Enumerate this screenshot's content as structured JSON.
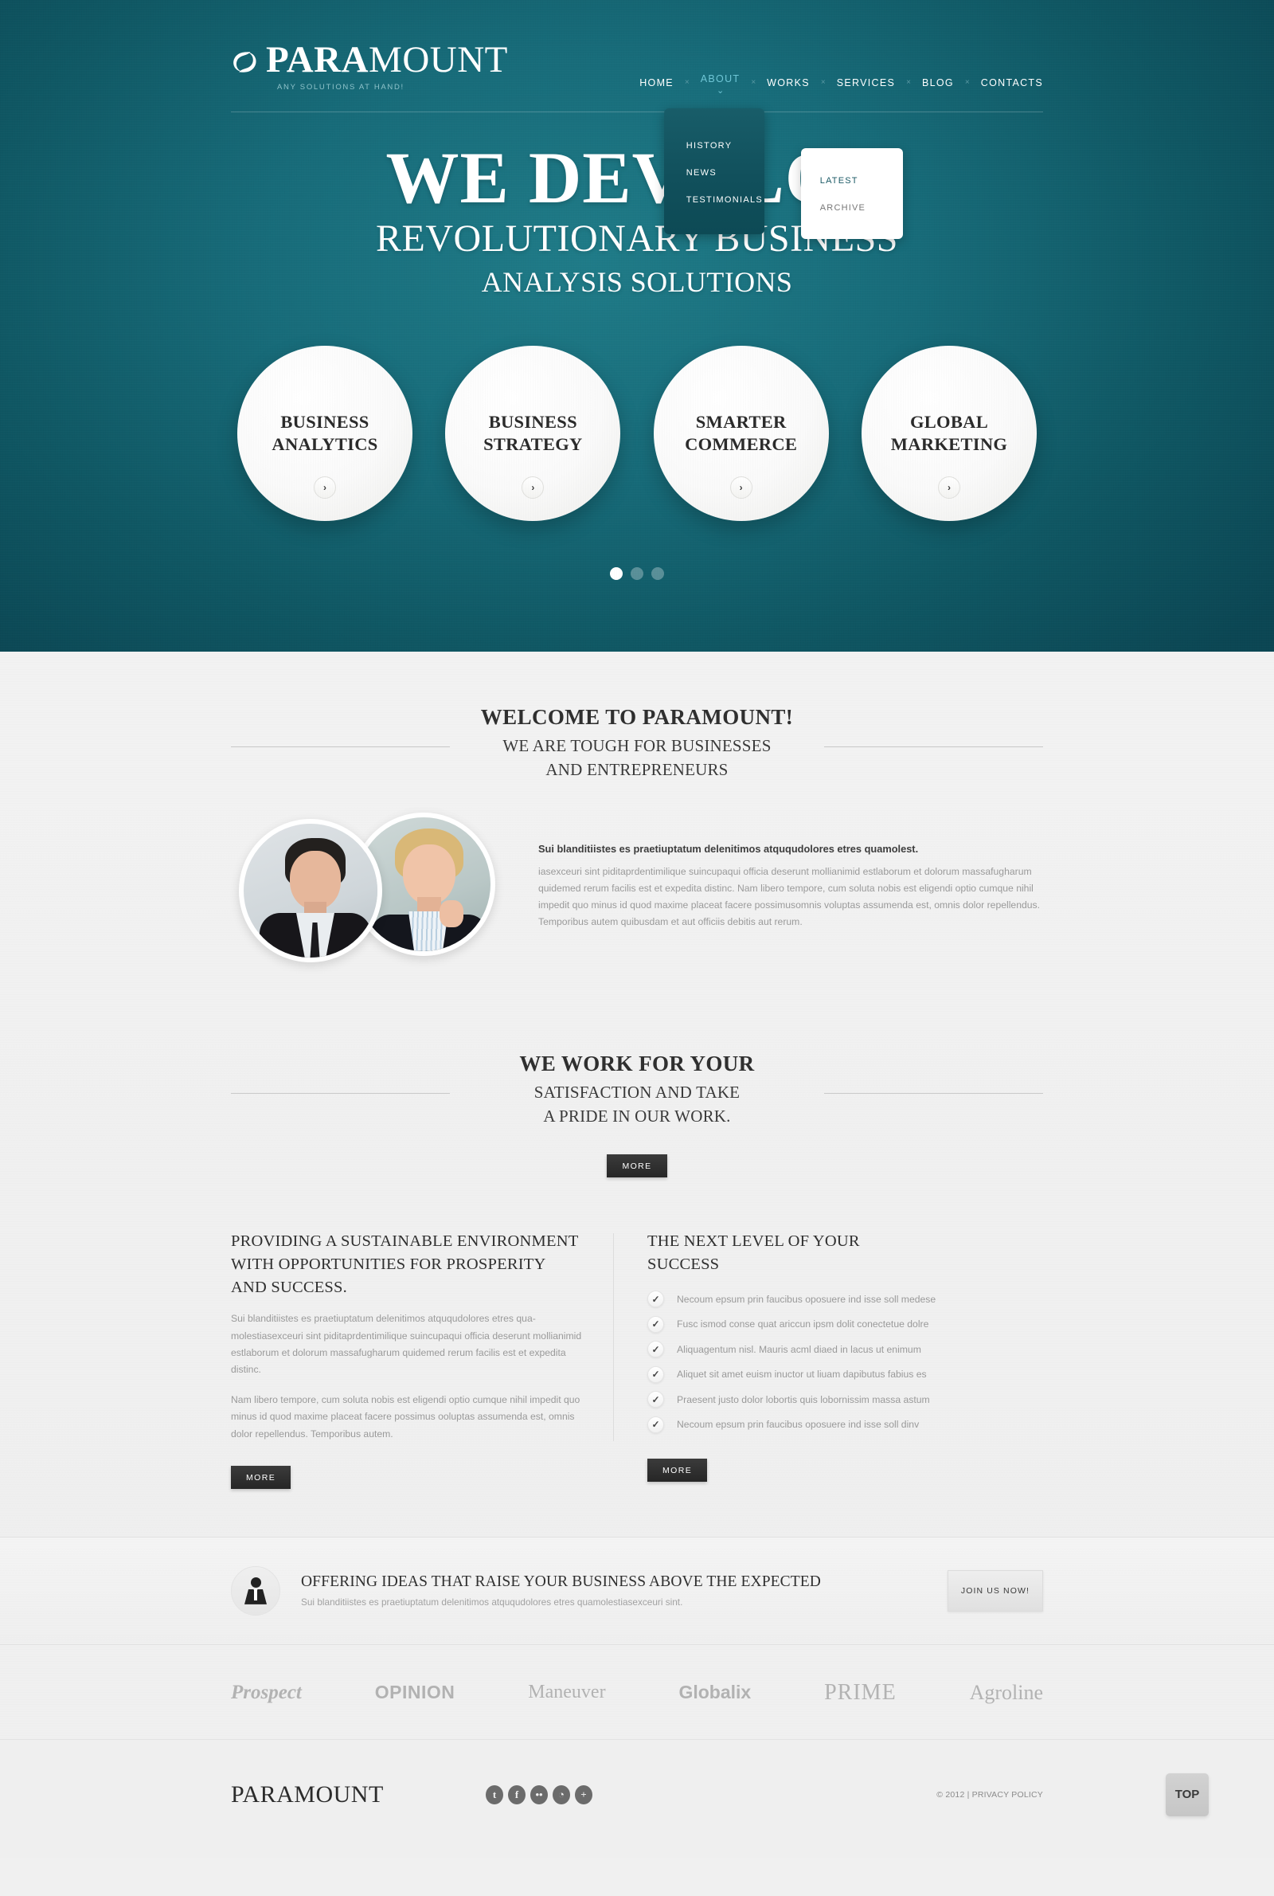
{
  "brand": {
    "name_light": "PARA",
    "name_rest": "MOUNT",
    "full": "PARAMOUNT",
    "tagline": "ANY SOLUTIONS AT HAND!",
    "logo_icon": "swirl-circle-icon"
  },
  "nav": {
    "items": [
      {
        "label": "HOME",
        "active": false
      },
      {
        "label": "ABOUT",
        "active": true
      },
      {
        "label": "WORKS",
        "active": false
      },
      {
        "label": "SERVICES",
        "active": false
      },
      {
        "label": "BLOG",
        "active": false
      },
      {
        "label": "CONTACTS",
        "active": false
      }
    ],
    "separator": "×",
    "caret": "⌄",
    "dropdown": [
      {
        "label": "HISTORY"
      },
      {
        "label": "NEWS"
      },
      {
        "label": "TESTIMONIALS"
      }
    ],
    "submenu": [
      {
        "label": "LATEST",
        "muted": false
      },
      {
        "label": "ARCHIVE",
        "muted": true
      }
    ]
  },
  "hero": {
    "title": "WE DEVELOP",
    "sub1": "REVOLUTIONARY BUSINESS",
    "sub2": "ANALYSIS SOLUTIONS",
    "circles": [
      {
        "line1": "BUSINESS",
        "line2": "ANALYTICS",
        "arrow": "›"
      },
      {
        "line1": "BUSINESS",
        "line2": "STRATEGY",
        "arrow": "›"
      },
      {
        "line1": "SMARTER",
        "line2": "COMMERCE",
        "arrow": "›"
      },
      {
        "line1": "GLOBAL",
        "line2": "MARKETING",
        "arrow": "›"
      }
    ],
    "slider_dots": 3,
    "active_dot": 1
  },
  "welcome": {
    "heading": "WELCOME TO PARAMOUNT!",
    "subheading_l1": "WE ARE TOUGH FOR BUSINESSES",
    "subheading_l2": "AND ENTREPRENEURS",
    "lead": "Sui blanditiistes es praetiuptatum delenitimos atququdolores etres quamolest.",
    "body": "iasexceuri sint piditaprdentimilique suincupaqui officia deserunt mollianimid estlaborum et dolorum massafugharum quidemed rerum facilis est et expedita distinc. Nam libero tempore, cum soluta nobis est eligendi optio cumque nihil impedit quo minus id quod maxime placeat facere possimusomnis voluptas assumenda est, omnis dolor repellendus. Temporibus autem quibusdam et aut officiis debitis aut rerum.",
    "photo1_alt": "businessman-portrait",
    "photo2_alt": "businesswoman-portrait"
  },
  "work": {
    "heading": "WE WORK FOR YOUR",
    "subheading_l1": "SATISFACTION AND TAKE",
    "subheading_l2": "A PRIDE IN OUR WORK.",
    "more_label": "MORE"
  },
  "columns": {
    "left": {
      "heading_l1": "PROVIDING A SUSTAINABLE ENVIRONMENT",
      "heading_l2": "WITH OPPORTUNITIES FOR PROSPERITY",
      "heading_l3": "AND SUCCESS.",
      "p1": "Sui blanditiistes es praetiuptatum delenitimos atququdolores etres qua-molestiasexceuri sint piditaprdentimilique suincupaqui officia deserunt mollianimid estlaborum et dolorum massafugharum quidemed rerum facilis est et expedita distinc.",
      "p2": "Nam libero tempore, cum soluta nobis est eligendi optio cumque nihil impedit quo minus id quod maxime placeat facere possimus ooluptas assumenda est, omnis dolor repellendus. Temporibus autem.",
      "more_label": "MORE"
    },
    "right": {
      "heading_l1": "THE NEXT LEVEL OF YOUR",
      "heading_l2": "SUCCESS",
      "check_icon": "✓",
      "items": [
        "Necoum epsum prin faucibus oposuere ind isse soll medese",
        "Fusc ismod conse quat ariccun ipsm dolit conectetue dolre",
        "Aliquagentum nisl. Mauris acml diaed in lacus ut enimum",
        "Aliquet sit amet euism inuctor ut liuam dapibutus fabius es",
        "Praesent justo dolor lobortis quis lobornissim massa astum",
        "Necoum epsum prin faucibus oposuere ind isse soll dinv"
      ],
      "more_label": "MORE"
    }
  },
  "cta": {
    "icon": "businessperson-icon",
    "heading": "OFFERING IDEAS THAT RAISE YOUR BUSINESS ABOVE THE EXPECTED",
    "text": "Sui blanditiistes es praetiuptatum delenitimos atququdolores etres quamolestiasexceuri sint.",
    "button_label": "JOIN US NOW!"
  },
  "partners": [
    {
      "name": "Prospect",
      "style": "pt1"
    },
    {
      "name": "OPINION",
      "style": "pt2"
    },
    {
      "name": "Maneuver",
      "style": "pt3"
    },
    {
      "name": "Globalix",
      "style": "pt4"
    },
    {
      "name": "PRIME",
      "style": "pt5"
    },
    {
      "name": "Agroline",
      "style": "pt6"
    }
  ],
  "footer": {
    "logo": "PARAMOUNT",
    "socials": [
      {
        "icon": "twitter-icon",
        "glyph": "t"
      },
      {
        "icon": "facebook-icon",
        "glyph": "f"
      },
      {
        "icon": "flickr-icon",
        "glyph": "••"
      },
      {
        "icon": "rss-icon",
        "glyph": "◔"
      },
      {
        "icon": "plus-icon",
        "glyph": "+"
      }
    ],
    "copyright": "© 2012 | PRIVACY POLICY",
    "top_label": "TOP"
  },
  "colors": {
    "hero_teal": "#176b79",
    "accent_cyan": "#6fc6d6",
    "dark_button": "#2b2b2b",
    "page_bg": "#f0f0f0"
  }
}
